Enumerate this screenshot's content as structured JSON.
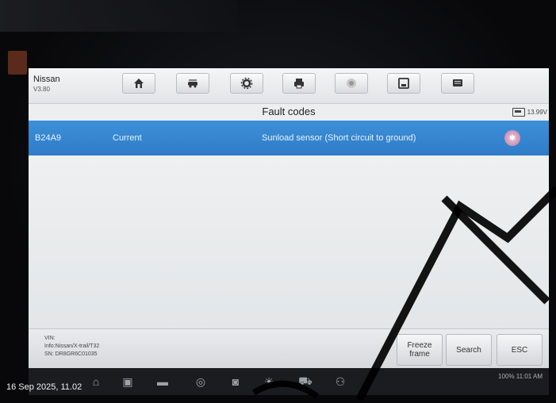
{
  "app": {
    "name": "Nissan",
    "version": "V3.80"
  },
  "toolbar": {
    "icons": [
      "home-icon",
      "vehicle-swap-icon",
      "settings-icon",
      "printer-icon",
      "record-icon",
      "save-icon",
      "message-icon"
    ]
  },
  "status": {
    "voltage": "13.99V"
  },
  "page": {
    "title": "Fault codes"
  },
  "faults": [
    {
      "code": "B24A9",
      "status": "Current",
      "description": "Sunload sensor (Short circuit to ground)"
    }
  ],
  "info": {
    "vin": "VIN:",
    "vehicle": "Info:Nissan/X-trail/T32",
    "sn": "SN: DR8GR6C01035"
  },
  "buttons": {
    "freeze_frame": "Freeze frame",
    "search": "Search",
    "esc": "ESC"
  },
  "system": {
    "status_text": "100% 11:01 AM"
  },
  "photo": {
    "timestamp": "16 Sep 2025, 11.02"
  },
  "colors": {
    "selected_row": "#2f7cc8",
    "screen_bg": "#eceeef"
  }
}
